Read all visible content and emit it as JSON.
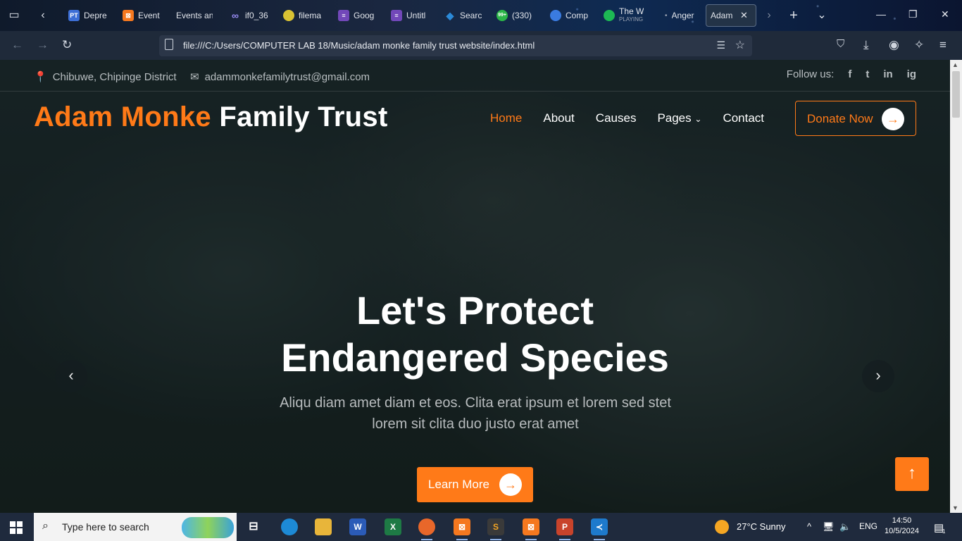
{
  "browser": {
    "tabs": [
      {
        "label": "Depre",
        "icon": "pt-icon",
        "color": "#3d6fd6",
        "glyph": "PT"
      },
      {
        "label": "Event",
        "icon": "xampp-icon",
        "color": "#f5781f",
        "glyph": "⊠"
      },
      {
        "label": "Events an",
        "icon": "",
        "color": "",
        "glyph": ""
      },
      {
        "label": "if0_36",
        "icon": "infinity-icon",
        "color": "#7f6cf0",
        "glyph": "∞"
      },
      {
        "label": "filema",
        "icon": "filemanager-icon",
        "color": "#d9c233",
        "glyph": "●"
      },
      {
        "label": "Goog",
        "icon": "google-forms-icon",
        "color": "#7248b9",
        "glyph": "≡"
      },
      {
        "label": "Untitl",
        "icon": "google-forms-icon",
        "color": "#7248b9",
        "glyph": "≡"
      },
      {
        "label": "Searc",
        "icon": "drupal-icon",
        "color": "#2b8ad8",
        "glyph": "◆"
      },
      {
        "label": "(330)",
        "icon": "whatsapp-icon",
        "color": "#2bb548",
        "glyph": "99+"
      },
      {
        "label": "Comp",
        "icon": "chat-icon",
        "color": "#3a7be0",
        "glyph": "◐"
      },
      {
        "label": "The W",
        "sublabel": "PLAYING",
        "icon": "spotify-icon",
        "color": "#1db954",
        "glyph": "≋"
      },
      {
        "label": "Anger",
        "icon": "dot-icon",
        "color": "",
        "glyph": "•"
      },
      {
        "label": "Adam M",
        "icon": "",
        "color": "",
        "glyph": "",
        "active": true
      }
    ],
    "url": "file:///C:/Users/COMPUTER LAB 18/Music/adam monke family trust website/index.html"
  },
  "site": {
    "topbar": {
      "location": "Chibuwe, Chipinge District",
      "email": "adammonkefamilytrust@gmail.com",
      "follow_label": "Follow us:",
      "social": [
        "f",
        "t",
        "in",
        "ig"
      ]
    },
    "brand": {
      "part1": "Adam Monke",
      "part2": "Family Trust"
    },
    "menu": [
      {
        "label": "Home",
        "active": true
      },
      {
        "label": "About"
      },
      {
        "label": "Causes"
      },
      {
        "label": "Pages",
        "dropdown": true
      },
      {
        "label": "Contact"
      }
    ],
    "donate_label": "Donate Now",
    "hero": {
      "title_line1": "Let's Protect",
      "title_line2": "Endangered Species",
      "subtitle": "Aliqu diam amet diam et eos. Clita erat ipsum et lorem sed stet lorem sit clita duo justo erat amet",
      "cta_label": "Learn More"
    }
  },
  "taskbar": {
    "search_placeholder": "Type here to search",
    "weather": "27°C  Sunny",
    "lang": "ENG",
    "time": "14:50",
    "date": "10/5/2024",
    "notifications": "1"
  }
}
